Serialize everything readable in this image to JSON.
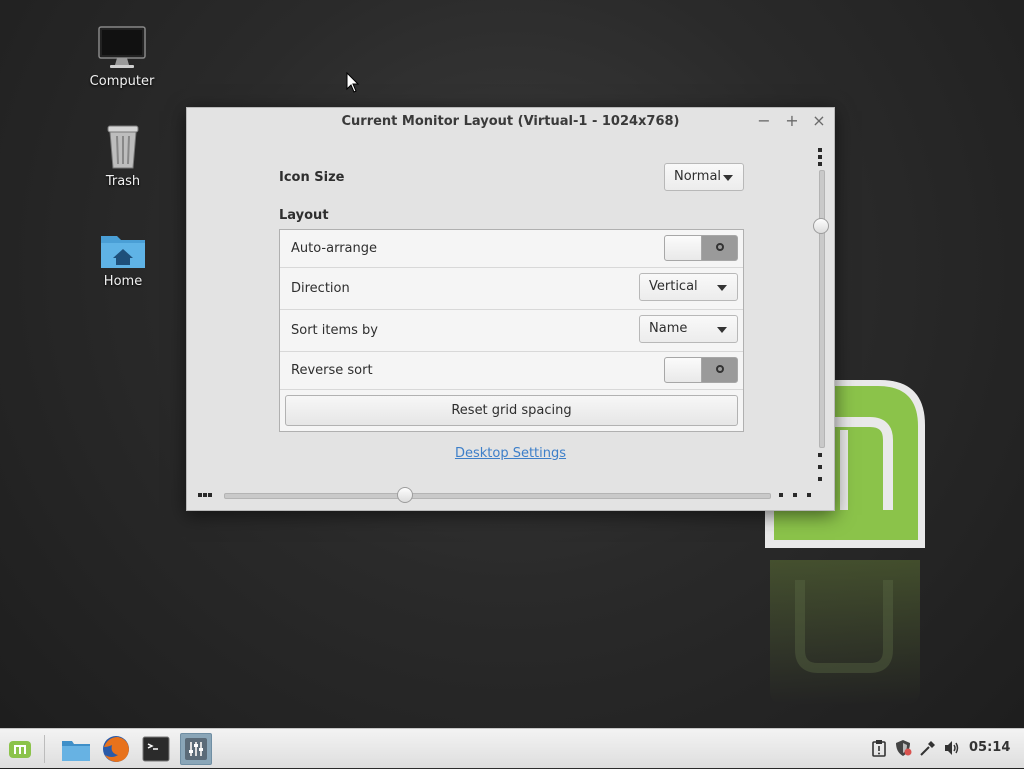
{
  "desktop": {
    "icons": [
      {
        "label": "Computer",
        "icon": "computer-icon"
      },
      {
        "label": "Trash",
        "icon": "trash-icon"
      },
      {
        "label": "Home",
        "icon": "home-folder-icon"
      }
    ]
  },
  "window": {
    "title": "Current Monitor Layout (Virtual-1 - 1024x768)",
    "controls": {
      "minimize": "−",
      "maximize": "+",
      "close": "×"
    },
    "icon_size": {
      "label": "Icon Size",
      "value": "Normal"
    },
    "layout": {
      "heading": "Layout",
      "auto_arrange": {
        "label": "Auto-arrange",
        "enabled": false
      },
      "direction": {
        "label": "Direction",
        "value": "Vertical"
      },
      "sort_items_by": {
        "label": "Sort items by",
        "value": "Name"
      },
      "reverse_sort": {
        "label": "Reverse sort",
        "enabled": false
      },
      "reset_button": "Reset grid spacing"
    },
    "link": "Desktop Settings",
    "vertical_spacing_level": 0.2,
    "horizontal_spacing_level": 0.33
  },
  "panel": {
    "launchers": [
      "menu-icon",
      "file-manager-icon",
      "firefox-icon",
      "terminal-icon",
      "desktop-settings-icon"
    ],
    "tray": [
      "clipboard-icon",
      "update-shield-icon",
      "network-icon",
      "volume-icon"
    ],
    "clock": "05:14"
  },
  "colors": {
    "mint_green": "#8bc34a",
    "link": "#3d7fc9",
    "active_task": "#8aa6b8"
  }
}
